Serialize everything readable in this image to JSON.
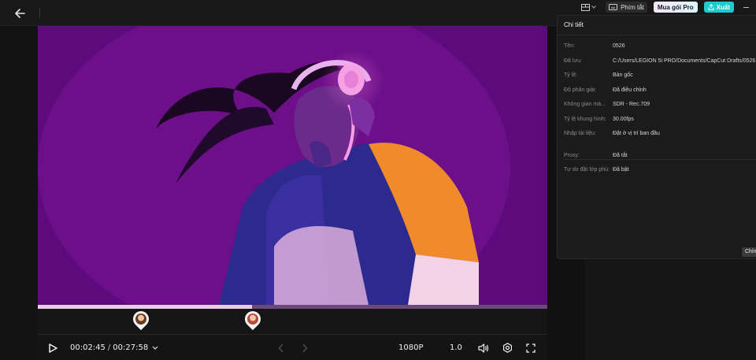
{
  "header": {
    "shortcut_label": "Phím tắt",
    "pro_label": "Mua gói Pro",
    "export_label": "Xuất"
  },
  "player": {
    "current_time": "00:02:45",
    "separator": "/",
    "total_time": "00:27:58",
    "resolution": "1080P",
    "speed": "1.0",
    "progress": 0.42
  },
  "details": {
    "title": "Chi tiết",
    "rows": [
      {
        "label": "Tên:",
        "value": "0526"
      },
      {
        "label": "Đã lưu:",
        "value": "C:/Users/LEGION 5i PRO/Documents/CapCut Drafts/0526"
      },
      {
        "label": "Tỷ lệ:",
        "value": "Bản gốc"
      },
      {
        "label": "Độ phân giải:",
        "value": "Đã điều chỉnh"
      },
      {
        "label": "Không gian mà...",
        "value": "SDR - Rec.709"
      },
      {
        "label": "Tỷ lệ khung hình:",
        "value": "30.00fps"
      },
      {
        "label": "Nhập tài liệu:",
        "value": "Đặt ở vị trí ban đầu"
      },
      {
        "label": "Proxy:",
        "value": "Đã tắt"
      },
      {
        "label": "Tự do đặt lớp phủ:",
        "value": "Đã bật"
      }
    ],
    "footer_button": "Chỉnh"
  },
  "icons": {
    "back": "arrow-left-icon",
    "play": "play-icon",
    "volume": "volume-icon",
    "settings": "gear-icon",
    "fullscreen": "fullscreen-icon"
  }
}
